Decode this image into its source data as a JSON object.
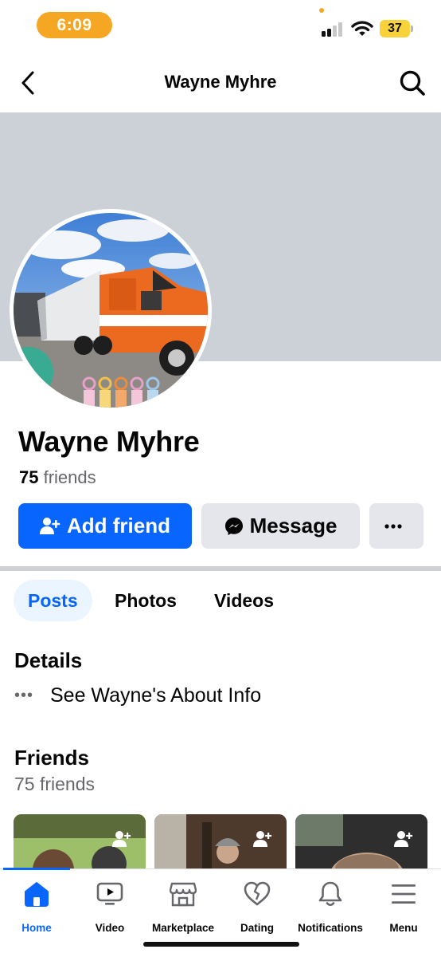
{
  "status_bar": {
    "time": "6:09",
    "battery": "37"
  },
  "header": {
    "title": "Wayne Myhre"
  },
  "profile": {
    "name": "Wayne Myhre",
    "friends_count": "75",
    "friends_word": "friends"
  },
  "actions": {
    "add_friend": "Add friend",
    "message": "Message"
  },
  "tabs": [
    {
      "label": "Posts",
      "active": true
    },
    {
      "label": "Photos",
      "active": false
    },
    {
      "label": "Videos",
      "active": false
    }
  ],
  "details": {
    "title": "Details",
    "about": "See Wayne's About Info"
  },
  "friends_section": {
    "title": "Friends",
    "subtitle": "75 friends"
  },
  "bottom_nav": [
    {
      "label": "Home",
      "icon": "home-icon",
      "active": true
    },
    {
      "label": "Video",
      "icon": "video-icon",
      "active": false
    },
    {
      "label": "Marketplace",
      "icon": "marketplace-icon",
      "active": false
    },
    {
      "label": "Dating",
      "icon": "dating-icon",
      "active": false
    },
    {
      "label": "Notifications",
      "icon": "bell-icon",
      "active": false
    },
    {
      "label": "Menu",
      "icon": "menu-icon",
      "active": false
    }
  ],
  "colors": {
    "accent": "#0866ff",
    "cover": "#ccd1d8",
    "button_gray": "#e4e6eb",
    "time_pill": "#f5a623"
  }
}
